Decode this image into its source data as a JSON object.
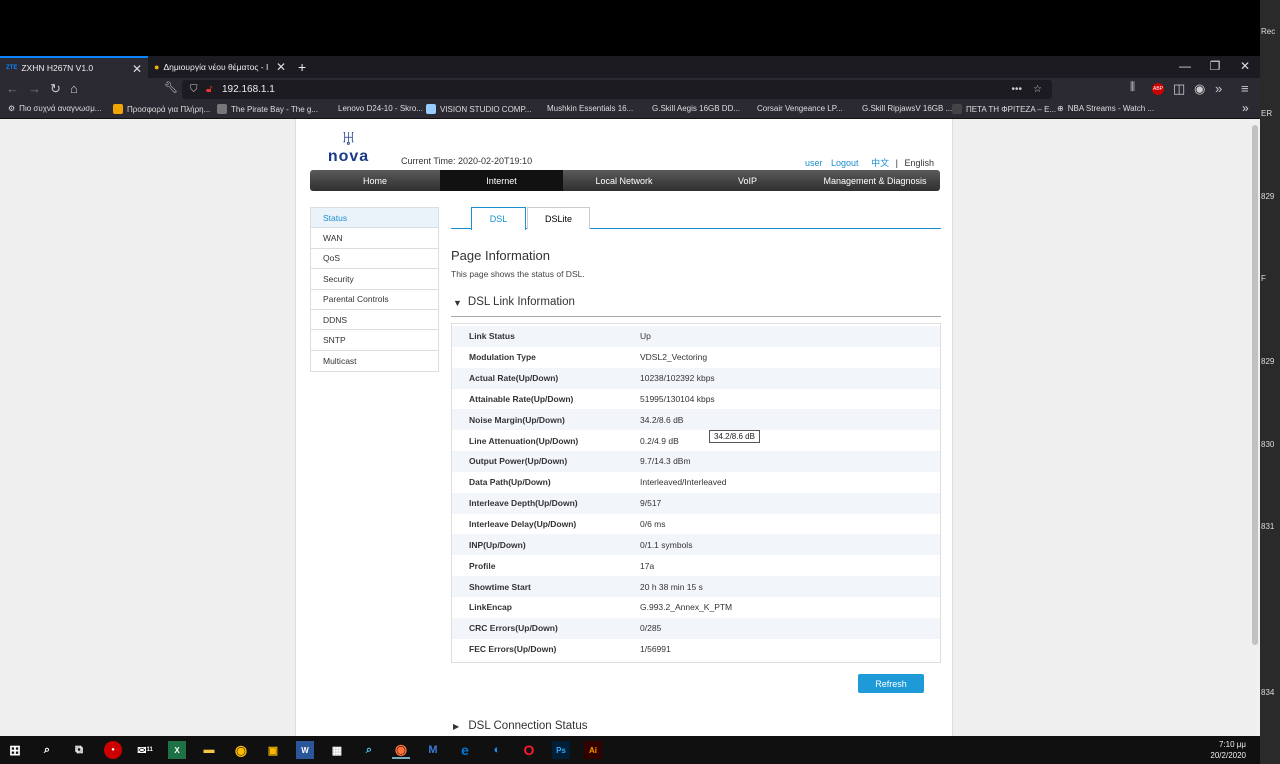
{
  "browser": {
    "tabs": [
      {
        "label": "ZXHN H267N V1.0",
        "icon": "zte-icon",
        "active": true
      },
      {
        "label": "Δημιουργία νέου θέματος - In",
        "icon": "forum-icon",
        "active": false
      }
    ],
    "new_tab": "+",
    "url": "192.168.1.1",
    "bookmarks": [
      {
        "label": "Πιο συχνά αναγνωσμ...",
        "color": "#888"
      },
      {
        "label": "Προσφορά για Πλήρη...",
        "color": "#f0a500"
      },
      {
        "label": "The Pirate Bay - The g...",
        "color": "#777"
      },
      {
        "label": "Lenovo D24-10 - Skro...",
        "color": "#2b2a33"
      },
      {
        "label": "VISION STUDIO COMP...",
        "color": "#9cf"
      },
      {
        "label": "Mushkin Essentials 16...",
        "color": "#2b2a33"
      },
      {
        "label": "G.Skill Aegis 16GB DD...",
        "color": "#2b2a33"
      },
      {
        "label": "Corsair Vengeance LP...",
        "color": "#2b2a33"
      },
      {
        "label": "G.Skill RipjawsV 16GB ...",
        "color": "#2b2a33"
      },
      {
        "label": "ΠΕΤΑ ΤΗ ΦΡΙΤΕΖΑ – Ε...",
        "color": "#333"
      },
      {
        "label": "NBA Streams - Watch ...",
        "color": "#666"
      }
    ]
  },
  "router": {
    "logo_text": "nova",
    "current_time": "Current Time: 2020-02-20T19:10",
    "links": {
      "user": "user",
      "logout": "Logout",
      "chinese": "中文",
      "separator": "|",
      "english": "English"
    },
    "nav": [
      "Home",
      "Internet",
      "Local Network",
      "VoIP",
      "Management & Diagnosis"
    ],
    "active_nav": "Internet",
    "sidebar": [
      "Status",
      "WAN",
      "QoS",
      "Security",
      "Parental Controls",
      "DDNS",
      "SNTP",
      "Multicast"
    ],
    "subtabs": [
      "DSL",
      "DSLite"
    ],
    "page_title": "Page Information",
    "page_desc": "This page shows the status of DSL.",
    "section_title": "DSL Link Information",
    "rows": [
      {
        "label": "Link Status",
        "value": "Up"
      },
      {
        "label": "Modulation Type",
        "value": "VDSL2_Vectoring"
      },
      {
        "label": "Actual Rate(Up/Down)",
        "value": "10238/102392 kbps"
      },
      {
        "label": "Attainable Rate(Up/Down)",
        "value": "51995/130104 kbps"
      },
      {
        "label": "Noise Margin(Up/Down)",
        "value": "34.2/8.6 dB"
      },
      {
        "label": "Line Attenuation(Up/Down)",
        "value": "0.2/4.9 dB"
      },
      {
        "label": "Output Power(Up/Down)",
        "value": "9.7/14.3 dBm"
      },
      {
        "label": "Data Path(Up/Down)",
        "value": "Interleaved/Interleaved"
      },
      {
        "label": "Interleave Depth(Up/Down)",
        "value": "9/517"
      },
      {
        "label": "Interleave Delay(Up/Down)",
        "value": "0/6 ms"
      },
      {
        "label": "INP(Up/Down)",
        "value": "0/1.1 symbols"
      },
      {
        "label": "Profile",
        "value": "17a"
      },
      {
        "label": "Showtime Start",
        "value": "20 h 38 min 15 s"
      },
      {
        "label": "LinkEncap",
        "value": "G.993.2_Annex_K_PTM"
      },
      {
        "label": "CRC Errors(Up/Down)",
        "value": "0/285"
      },
      {
        "label": "FEC Errors(Up/Down)",
        "value": "1/56991"
      }
    ],
    "tooltip": "34.2/8.6 dB",
    "refresh": "Refresh",
    "section2_title": "DSL Connection Status"
  },
  "right_strip": [
    "Rec",
    "ER",
    "829",
    "F",
    "829",
    "830",
    "831",
    "834"
  ],
  "taskbar": {
    "time": "7:10 μμ",
    "date": "20/2/2020",
    "mail_badge": "11"
  }
}
